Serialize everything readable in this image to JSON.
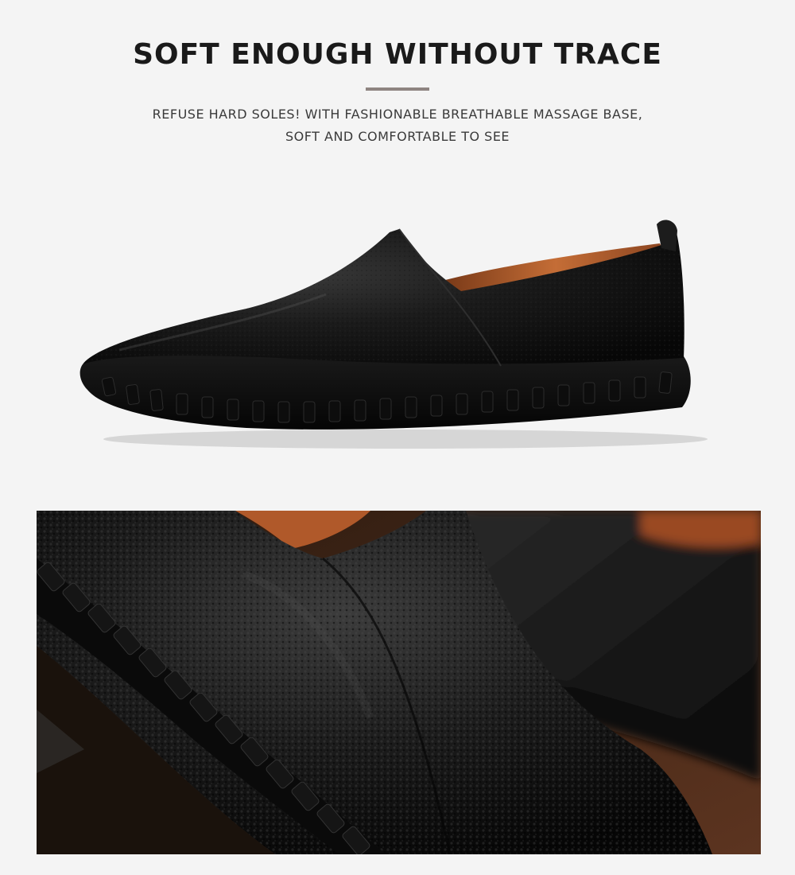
{
  "header": {
    "title": "SOFT ENOUGH WITHOUT TRACE",
    "description_line_1": "REFUSE HARD SOLES! WITH FASHIONABLE BREATHABLE MASSAGE BASE,",
    "description_line_2": "SOFT AND COMFORTABLE TO SEE"
  },
  "colors": {
    "background": "#f4f4f4",
    "accent_bar": "#8e8481",
    "leather": "#121212",
    "lining": "#b5622d"
  }
}
